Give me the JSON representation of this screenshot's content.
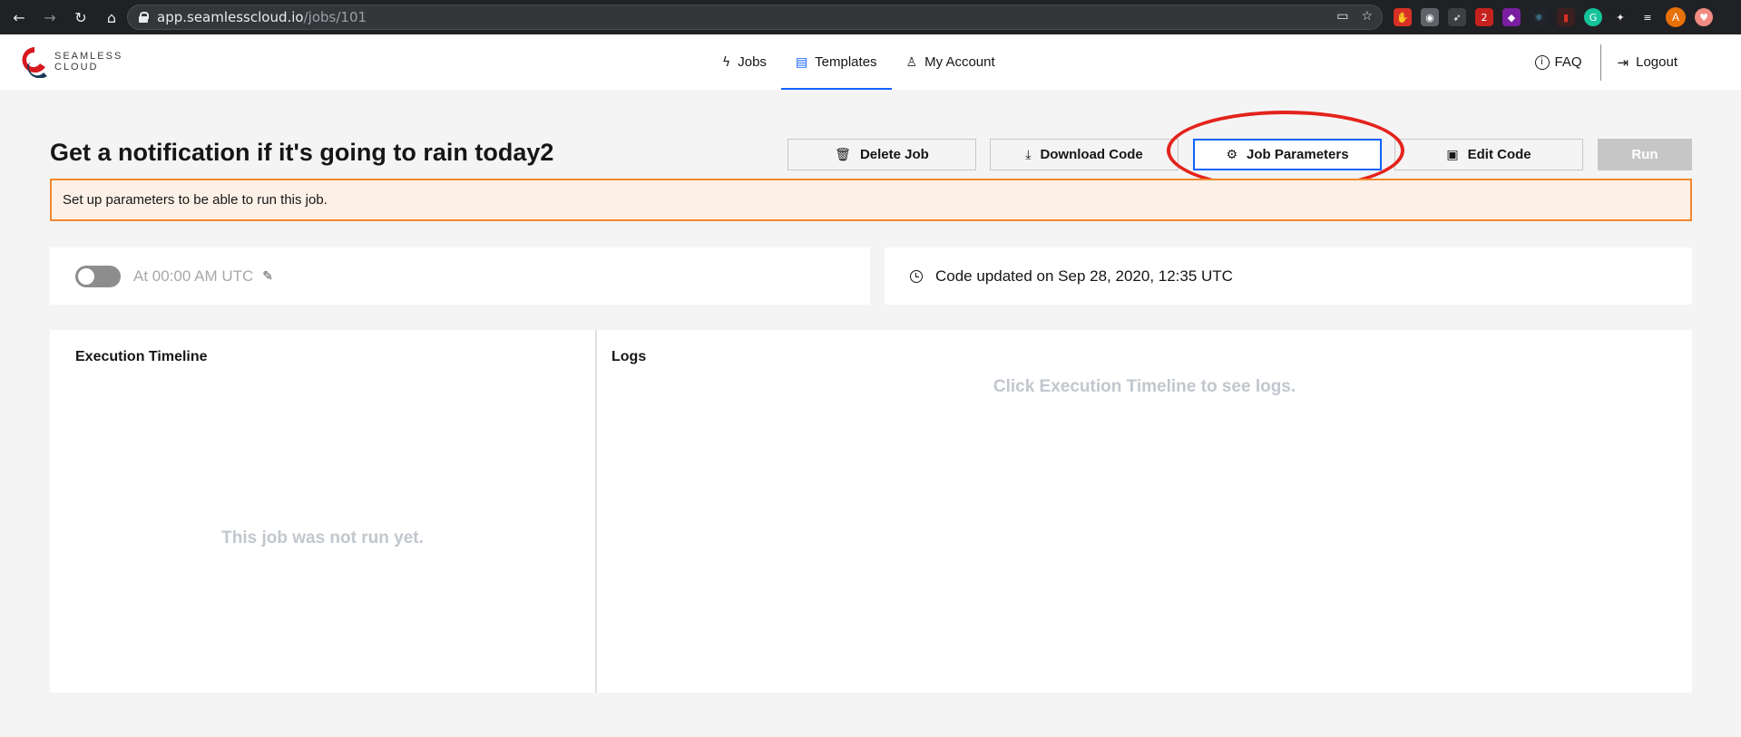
{
  "browser": {
    "url_host": "app.seamlesscloud.io",
    "url_path": "/jobs/101",
    "extension_badge": "2",
    "profile_initial": "A"
  },
  "header": {
    "logo_line1": "SEAMLESS",
    "logo_line2": "CLOUD",
    "nav": [
      {
        "label": "Jobs",
        "icon": "bolt-icon"
      },
      {
        "label": "Templates",
        "icon": "document-icon"
      },
      {
        "label": "My Account",
        "icon": "user-icon"
      }
    ],
    "faq_label": "FAQ",
    "logout_label": "Logout"
  },
  "job": {
    "title": "Get a notification if it's going to rain today2",
    "buttons": {
      "delete": "Delete Job",
      "download": "Download Code",
      "params": "Job Parameters",
      "edit": "Edit Code",
      "run": "Run"
    },
    "warning": "Set up parameters to be able to run this job.",
    "schedule": "At 00:00 AM UTC",
    "schedule_enabled": false,
    "code_updated": "Code updated on Sep 28, 2020, 12:35 UTC"
  },
  "timeline": {
    "heading": "Execution Timeline",
    "empty": "This job was not run yet."
  },
  "logs": {
    "heading": "Logs",
    "empty": "Click Execution Timeline to see logs."
  },
  "colors": {
    "accent": "#0f62fe",
    "warning_border": "#f1882f",
    "warning_bg": "#fdf0e6",
    "annotation": "#e3231c"
  }
}
